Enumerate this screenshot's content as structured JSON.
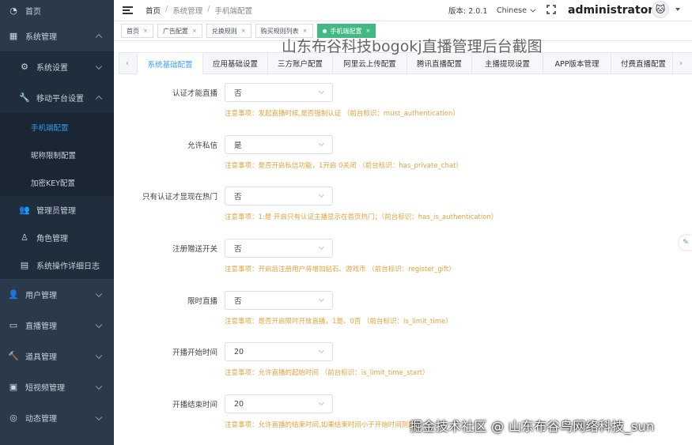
{
  "sidebar": {
    "items": [
      {
        "label": "首页",
        "icon": "dashboard-icon"
      },
      {
        "label": "系统管理",
        "icon": "grid-icon"
      },
      {
        "label": "系统设置",
        "icon": "gear-icon"
      },
      {
        "label": "移动平台设置",
        "icon": "wrench-icon"
      },
      {
        "label": "手机端配置"
      },
      {
        "label": "昵称限制配置"
      },
      {
        "label": "加密KEY配置"
      },
      {
        "label": "管理员管理",
        "icon": "users-icon"
      },
      {
        "label": "角色管理",
        "icon": "user-role-icon"
      },
      {
        "label": "系统操作详细日志",
        "icon": "log-icon"
      },
      {
        "label": "用户管理",
        "icon": "user-icon"
      },
      {
        "label": "直播管理",
        "icon": "video-icon"
      },
      {
        "label": "道具管理",
        "icon": "gavel-icon"
      },
      {
        "label": "短视频管理",
        "icon": "film-icon"
      },
      {
        "label": "动态管理",
        "icon": "compass-icon"
      }
    ]
  },
  "header": {
    "breadcrumb": [
      "首页",
      "系统管理",
      "手机端配置"
    ],
    "version": "版本: 2.0.1",
    "language": "Chinese",
    "username": "administrator"
  },
  "tags": [
    {
      "label": "首页"
    },
    {
      "label": "广告配置"
    },
    {
      "label": "兑换规则"
    },
    {
      "label": "购买规则列表"
    },
    {
      "label": "手机端配置",
      "active": true
    }
  ],
  "watermark": {
    "top": "山东布谷科技bogokj直播管理后台截图",
    "bottom": "掘金技术社区 @ 山东布谷鸟网络科技_sun"
  },
  "tabs": [
    "系统基础配置",
    "应用基础设置",
    "三方账户配置",
    "阿里云上传配置",
    "腾讯直播配置",
    "主播提现设置",
    "APP版本管理",
    "付费直播配置"
  ],
  "form": [
    {
      "label": "认证才能直播",
      "value": "否",
      "note": "注意事项：发起直播时候,是否强制认证 （前台标识：must_authentication）"
    },
    {
      "label": "允许私信",
      "value": "是",
      "note": "注意事项：是否开启私信功能，1开启 0关闭 （前台标识：has_private_chat）"
    },
    {
      "label": "只有认证才显现在热门",
      "value": "否",
      "note": "注意事项：1:是 开启只有认证主播显示在首页热门；（前台标识：has_is_authentication）"
    },
    {
      "label": "注册赠送开关",
      "value": "否",
      "note": "注意事项：开启后注册用户将增加钻石、游戏币 （前台标识：register_gift）"
    },
    {
      "label": "限时直播",
      "value": "否",
      "note": "注意事项：是否开启限时开放直播，1是、0否 （前台标识：is_limit_time）"
    },
    {
      "label": "开播开始时间",
      "value": "20",
      "note": "注意事项：允许直播的起始时间 （前台标识：is_limit_time_start）"
    },
    {
      "label": "开播结束时间",
      "value": "20",
      "note": "注意事项：允许直播的结束时间,如果结束时间小于开始时间则跨天"
    }
  ],
  "colors": {
    "sidebar_bg": "#2b3a4a",
    "active_link": "#2f9cf0",
    "tag_active": "#42b983",
    "tab_active": "#409eff",
    "note": "#e6a23c"
  }
}
